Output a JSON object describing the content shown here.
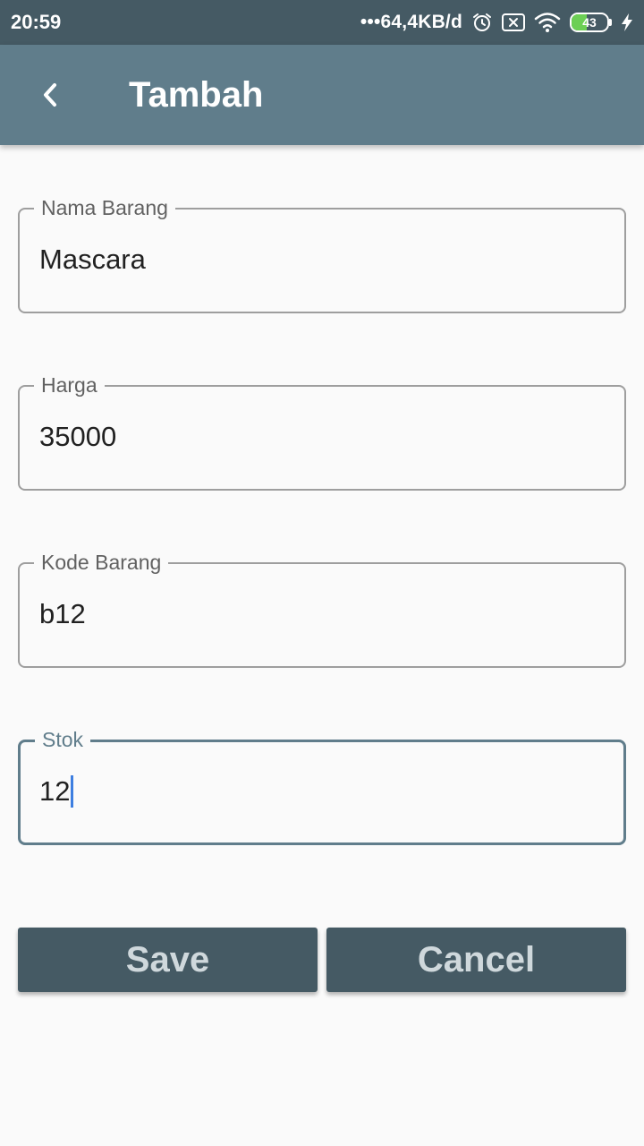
{
  "status_bar": {
    "time": "20:59",
    "network_speed": "•••64,4KB/d",
    "battery_level": "43",
    "battery_fill_fraction": 0.43,
    "icons": [
      "alarm-icon",
      "sim-off-icon",
      "wifi-icon",
      "battery-icon",
      "charging-bolt-icon"
    ]
  },
  "app_bar": {
    "back_icon": "chevron-left-icon",
    "title": "Tambah"
  },
  "form": {
    "nama_barang": {
      "label": "Nama Barang",
      "value": "Mascara"
    },
    "harga": {
      "label": "Harga",
      "value": "35000"
    },
    "kode_barang": {
      "label": "Kode Barang",
      "value": "b12"
    },
    "stok": {
      "label": "Stok",
      "value": "12",
      "focused": true
    }
  },
  "actions": {
    "save_label": "Save",
    "cancel_label": "Cancel"
  },
  "colors": {
    "status_bar": "#455a64",
    "app_bar": "#607d8b",
    "button": "#455a64",
    "button_text": "#cfd8dc",
    "focus_border": "#607d8b",
    "caret": "#3d7ee0",
    "background": "#fafafa"
  }
}
